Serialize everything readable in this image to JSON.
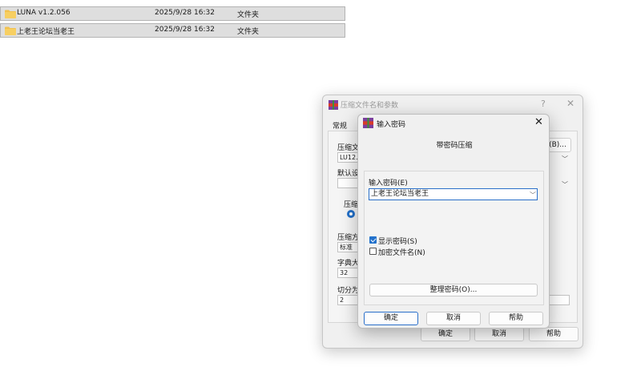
{
  "file_list": {
    "rows": [
      {
        "name": "LUNA v1.2.056",
        "date": "2025/9/28 16:32",
        "type": "文件夹"
      },
      {
        "name": "上老王论坛当老王",
        "date": "2025/9/28 16:32",
        "type": "文件夹"
      }
    ]
  },
  "archive_dialog": {
    "title": "压缩文件名和参数",
    "help": "?",
    "close": "✕",
    "tab": "常规",
    "archive_name_label": "压缩文",
    "archive_name_value": "LU12.r",
    "browse_label": "(B)...",
    "default_label": "默认设",
    "format_label": "压缩",
    "method_label": "压缩方",
    "method_value": "标准",
    "dict_label": "字典大",
    "dict_value": "32",
    "split_label": "切分为",
    "split_value": "2",
    "ok": "确定",
    "cancel": "取消",
    "help_btn": "帮助"
  },
  "password_dialog": {
    "title": "输入密码",
    "close": "✕",
    "heading": "带密码压缩",
    "password_label": "输入密码(E)",
    "password_value": "上老王论坛当老王",
    "show_password_label": "显示密码(S)",
    "show_password_checked": true,
    "encrypt_names_label": "加密文件名(N)",
    "encrypt_names_checked": false,
    "organize_label": "整理密码(O)...",
    "ok": "确定",
    "cancel": "取消",
    "help": "帮助"
  },
  "colors": {
    "accent": "#2372cc",
    "folder": "#f2c14e"
  }
}
